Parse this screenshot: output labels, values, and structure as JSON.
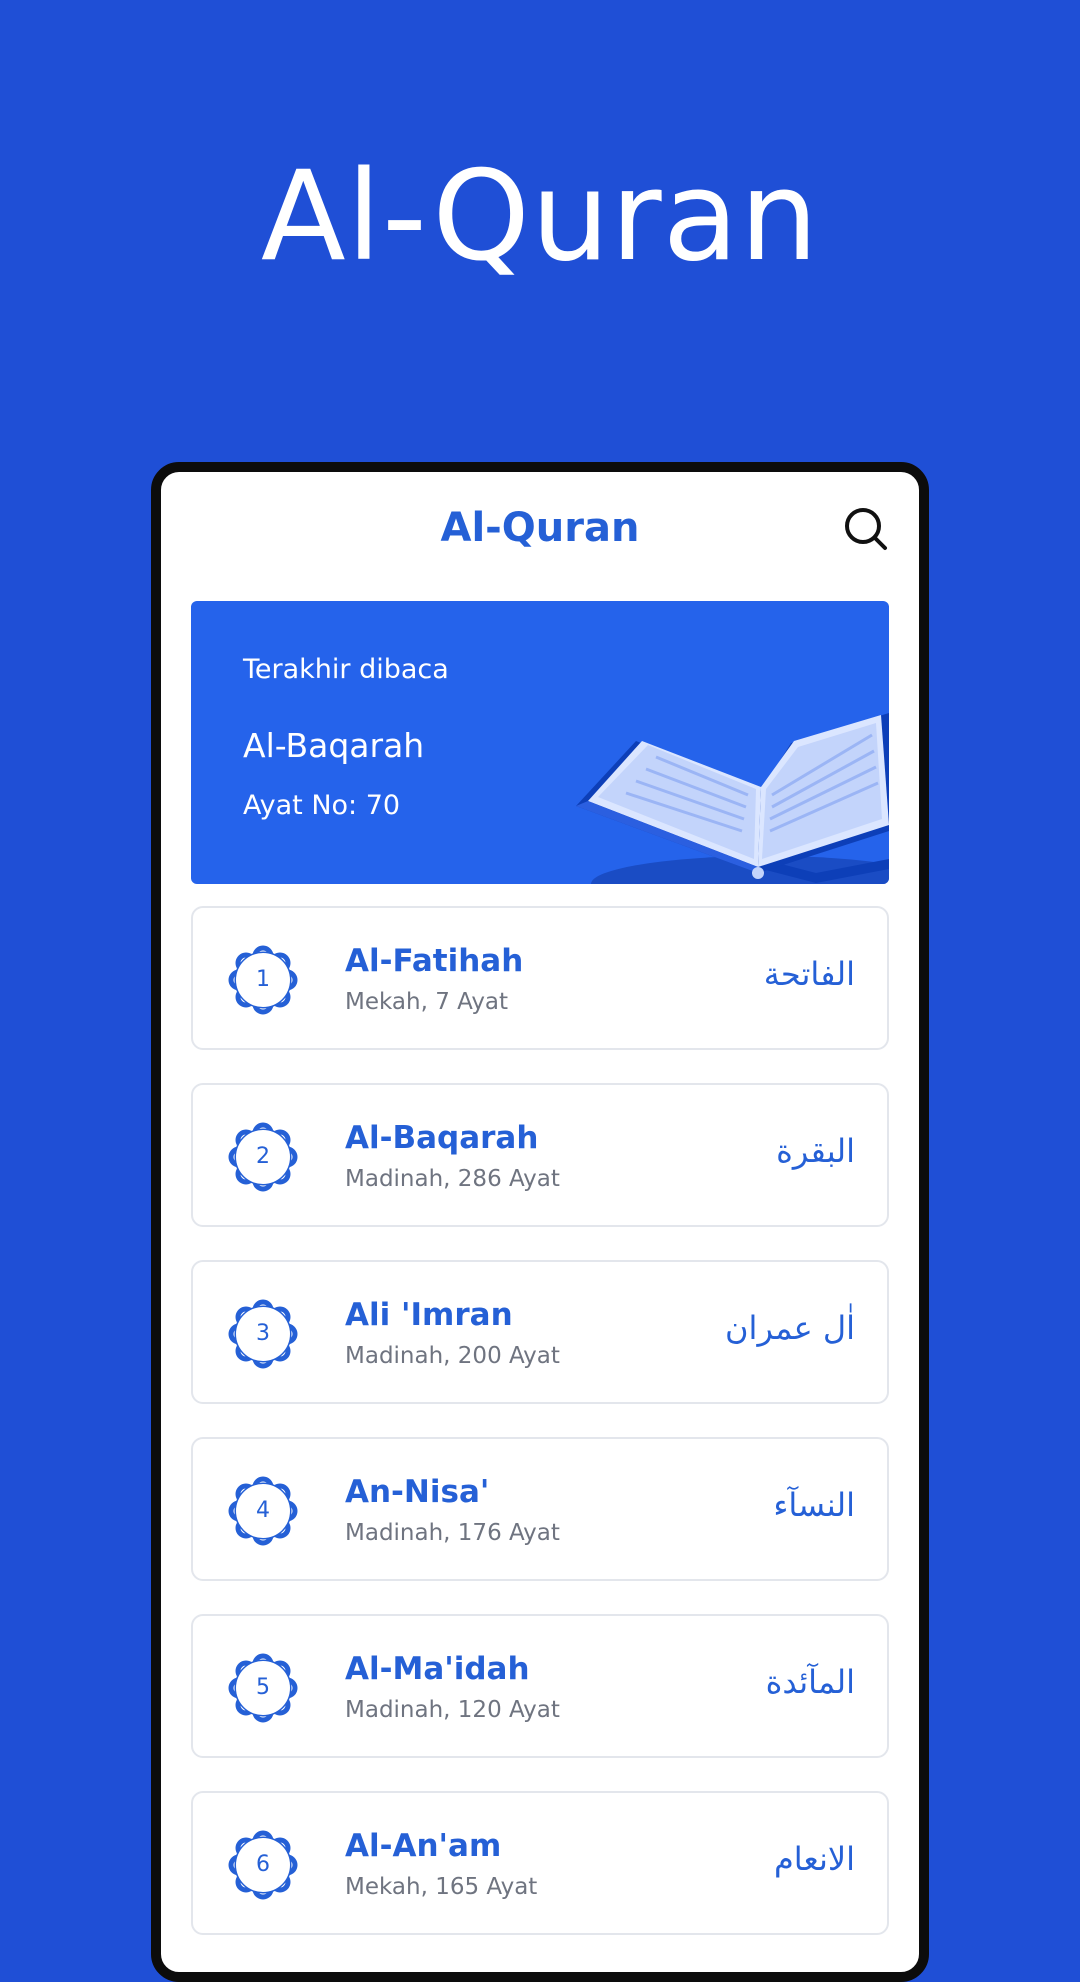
{
  "hero": {
    "title": "Al-Quran"
  },
  "app": {
    "title": "Al-Quran",
    "search_icon": "search-icon"
  },
  "last_read": {
    "label": "Terakhir dibaca",
    "surah": "Al-Baqarah",
    "ayat": "Ayat No: 70",
    "illustration": "open-quran-book"
  },
  "surahs": [
    {
      "number": "1",
      "name": "Al-Fatihah",
      "meta": "Mekah, 7 Ayat",
      "arabic": "الفاتحة"
    },
    {
      "number": "2",
      "name": "Al-Baqarah",
      "meta": "Madinah, 286 Ayat",
      "arabic": "البقرة"
    },
    {
      "number": "3",
      "name": "Ali 'Imran",
      "meta": "Madinah, 200 Ayat",
      "arabic": "اٰل عمران"
    },
    {
      "number": "4",
      "name": "An-Nisa'",
      "meta": "Madinah, 176 Ayat",
      "arabic": "النسآء"
    },
    {
      "number": "5",
      "name": "Al-Ma'idah",
      "meta": "Madinah, 120 Ayat",
      "arabic": "المآئدة"
    },
    {
      "number": "6",
      "name": "Al-An'am",
      "meta": "Mekah, 165 Ayat",
      "arabic": "الانعام"
    }
  ],
  "colors": {
    "background": "#1f4fd6",
    "accent": "#2560d6",
    "card": "#2563eb",
    "meta_text": "#6f7480"
  }
}
